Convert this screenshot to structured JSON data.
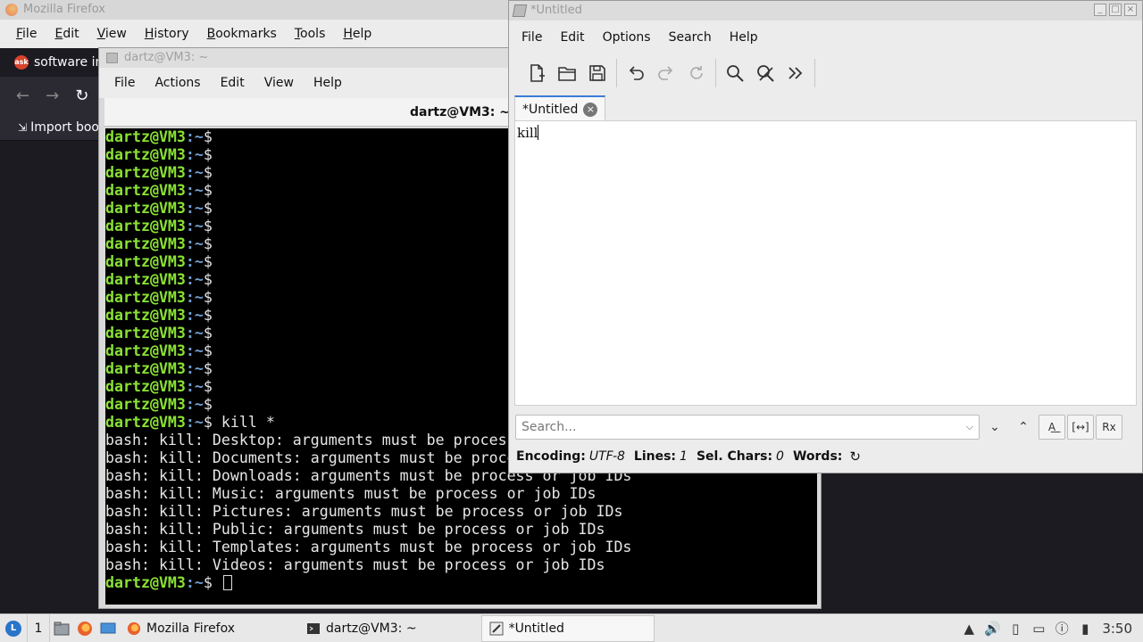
{
  "firefox": {
    "title": "Mozilla Firefox",
    "menu": [
      "File",
      "Edit",
      "View",
      "History",
      "Bookmarks",
      "Tools",
      "Help"
    ],
    "tab_label": "software inst",
    "bookmark_label": "Import boo"
  },
  "terminal": {
    "title": "dartz@VM3: ~",
    "menu": [
      "File",
      "Actions",
      "Edit",
      "View",
      "Help"
    ],
    "tab_label": "dartz@VM3: ~",
    "user": "dartz@VM3",
    "path": ":~",
    "dollar": "$",
    "empty_prompt_count": 16,
    "command": " kill *",
    "output": [
      "bash: kill: Desktop: arguments must be process or job IDs",
      "bash: kill: Documents: arguments must be process or job IDs",
      "bash: kill: Downloads: arguments must be process or job IDs",
      "bash: kill: Music: arguments must be process or job IDs",
      "bash: kill: Pictures: arguments must be process or job IDs",
      "bash: kill: Public: arguments must be process or job IDs",
      "bash: kill: Templates: arguments must be process or job IDs",
      "bash: kill: Videos: arguments must be process or job IDs"
    ]
  },
  "editor": {
    "title": "*Untitled",
    "menu": [
      "File",
      "Edit",
      "Options",
      "Search",
      "Help"
    ],
    "tab_label": "*Untitled",
    "content": "kill",
    "search_placeholder": "Search...",
    "status": {
      "encoding_label": "Encoding:",
      "encoding_value": "UTF-8",
      "lines_label": "Lines:",
      "lines_value": "1",
      "sel_label": "Sel. Chars:",
      "sel_value": "0",
      "words_label": "Words:"
    }
  },
  "taskbar": {
    "desktop_number": "1",
    "tasks": [
      "Mozilla Firefox",
      "dartz@VM3: ~",
      "*Untitled"
    ],
    "clock": "3:50"
  }
}
